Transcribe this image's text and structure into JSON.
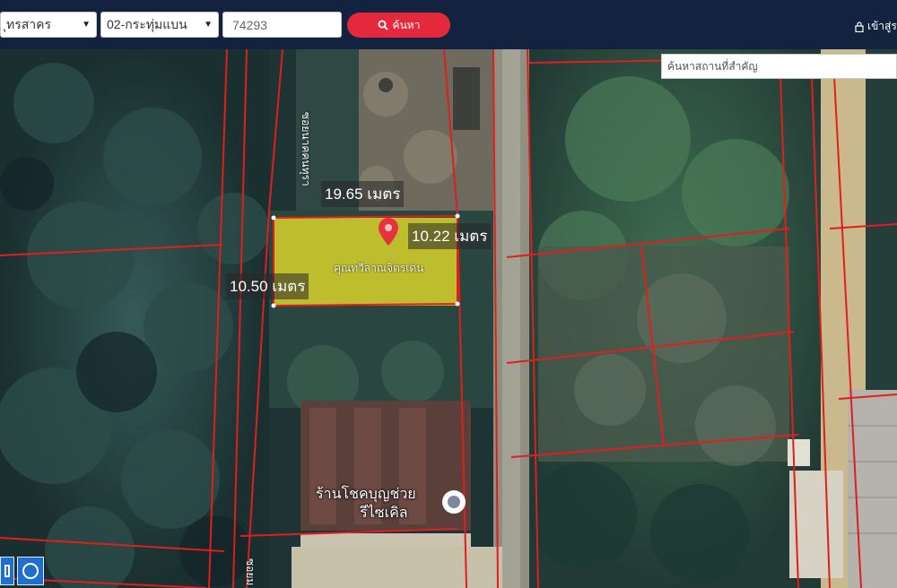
{
  "header": {
    "province": "ุทรสาคร",
    "district": "02-กระทุ่มแบน",
    "parcel_number": "74293",
    "search_label": "ค้นหา",
    "login_label": "เข้าสู่ร"
  },
  "map": {
    "landmark_search_placeholder": "ค้นหาสถานที่สำคัญ",
    "measurements": {
      "top": "19.65 เมตร",
      "right": "10.22 เมตร",
      "left": "10.50 เมตร"
    },
    "parcel_label": "คุณทวีลาณจิตรเด่น",
    "road_label_top": "ซอยนาคคนทุรา",
    "road_label_bottom": "ซอยม",
    "shop_label_line1": "ร้านโชคบุญช่วย",
    "shop_label_line2": "รีไซเคิล"
  },
  "colors": {
    "header_bg": "#13233f",
    "search_button": "#e5293d",
    "parcel_fill": "#d8d22a",
    "boundary_line": "#e01e1e",
    "pin": "#e4333c",
    "tool_button": "#1f6fd1"
  },
  "icons": [
    "chevron-down-icon",
    "search-icon",
    "lock-icon",
    "location-pin-icon",
    "place-pin-icon",
    "rectangle-tool-icon",
    "circle-tool-icon"
  ]
}
